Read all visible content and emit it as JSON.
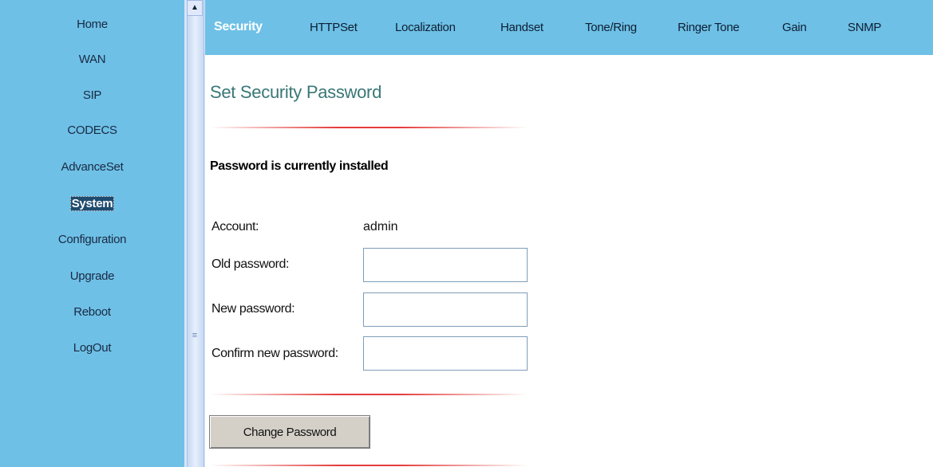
{
  "sidebar": {
    "items": [
      {
        "label": "Home"
      },
      {
        "label": "WAN"
      },
      {
        "label": "SIP"
      },
      {
        "label": "CODECS"
      },
      {
        "label": "AdvanceSet"
      },
      {
        "label": "System"
      },
      {
        "label": "Configuration"
      },
      {
        "label": "Upgrade"
      },
      {
        "label": "Reboot"
      },
      {
        "label": "LogOut"
      }
    ],
    "active": "System"
  },
  "tabs": [
    {
      "label": "Security"
    },
    {
      "label": "HTTPSet"
    },
    {
      "label": "Localization"
    },
    {
      "label": "Handset"
    },
    {
      "label": "Tone/Ring"
    },
    {
      "label": "Ringer Tone"
    },
    {
      "label": "Gain"
    },
    {
      "label": "SNMP"
    }
  ],
  "main": {
    "title": "Set Security Password",
    "status": "Password is currently installed",
    "account_label": "Account:",
    "account_value": "admin",
    "old_password_label": "Old password:",
    "new_password_label": "New password:",
    "confirm_password_label": "Confirm new password:",
    "old_password_value": "",
    "new_password_value": "",
    "confirm_password_value": "",
    "button_label": "Change Password"
  },
  "colors": {
    "sidebar_bg": "#6ec0e6",
    "title_color": "#3a7777",
    "separator": "#e43c3c"
  },
  "icons": {
    "scroll_up": "scroll-up-arrow-icon",
    "grip": "splitter-grip-icon"
  }
}
